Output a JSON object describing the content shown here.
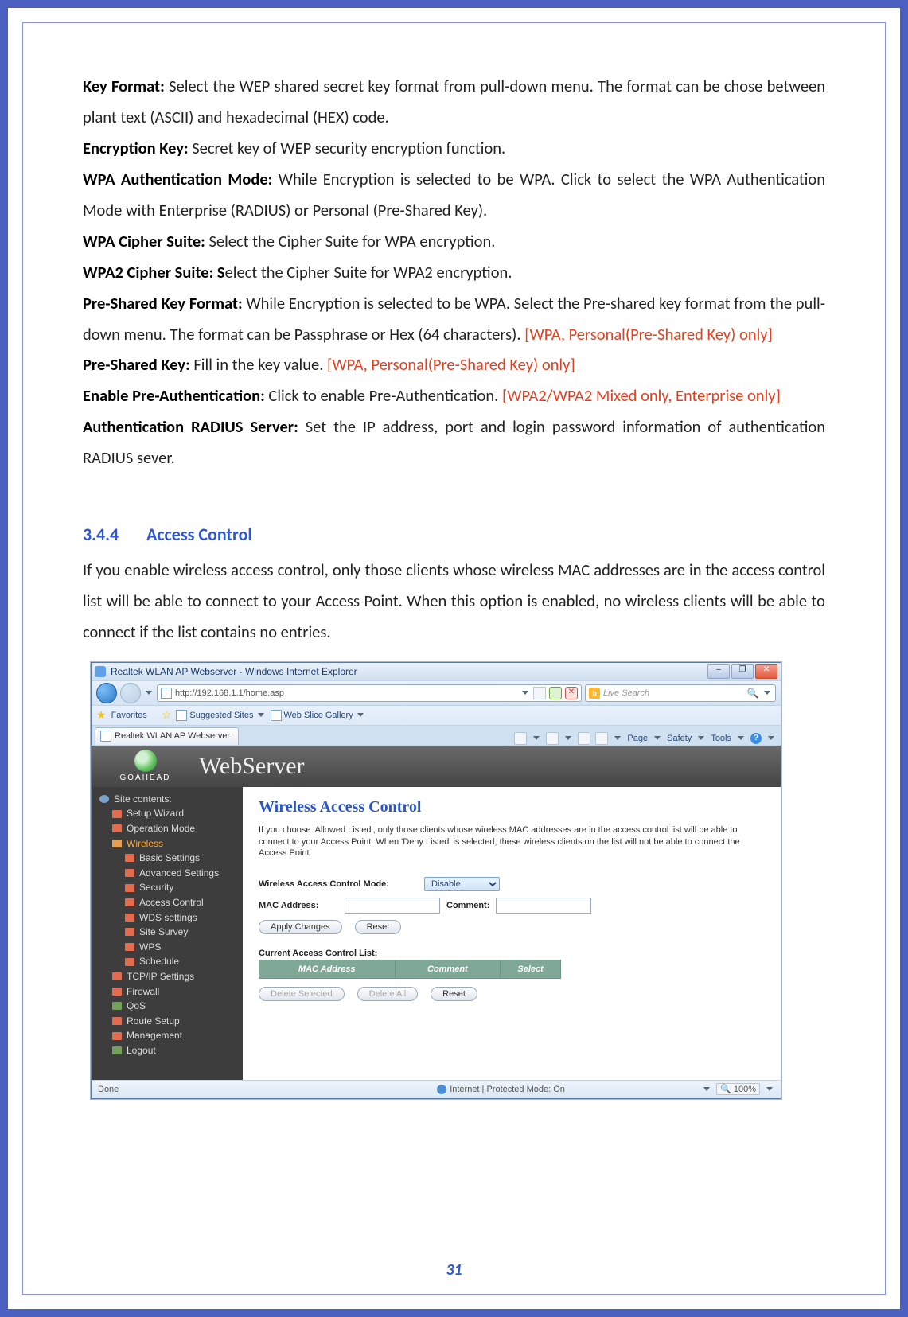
{
  "page_number": "31",
  "doc": {
    "p1_b": "Key Format:",
    "p1_t": " Select the WEP shared secret key format from pull-down menu. The format can be chose between plant text (ASCII) and hexadecimal (HEX) code.",
    "p2_b": "Encryption Key:",
    "p2_t": " Secret key of WEP security encryption function.",
    "p3_b": "WPA Authentication Mode:",
    "p3_t": " While Encryption is selected to be WPA. Click to select the WPA Authentication Mode with Enterprise (RADIUS) or Personal (Pre-Shared Key).",
    "p4_b": "WPA Cipher Suite:",
    "p4_t": " Select the Cipher Suite for WPA encryption.",
    "p5_b": "WPA2 Cipher Suite: S",
    "p5_t": "elect the Cipher Suite for WPA2 encryption.",
    "p6_b": "Pre-Shared Key Format:",
    "p6_t": " While Encryption is selected to be WPA. Select the Pre-shared key format from the pull-down menu. The format can be Passphrase or Hex (64 characters). ",
    "p6_r": "[WPA, Personal(Pre-Shared Key) only]",
    "p7_b": "Pre-Shared Key:",
    "p7_t": " Fill in the key value. ",
    "p7_r": "[WPA, Personal(Pre-Shared Key) only]",
    "p8_b": "Enable Pre-Authentication:",
    "p8_t": " Click to enable Pre-Authentication. ",
    "p8_r": "[WPA2/WPA2 Mixed only, Enterprise only]",
    "p9_b": "Authentication RADIUS Server:",
    "p9_t": " Set the IP address, port and login password information of authentication RADIUS sever."
  },
  "sec": {
    "num": "3.4.4",
    "title": "Access Control",
    "body": "If you enable wireless access control, only those clients whose wireless MAC addresses are in the access control list will be able to connect to your Access Point. When this option is enabled, no wireless clients will be able to connect if the list contains no entries."
  },
  "ie": {
    "title": "Realtek WLAN AP Webserver - Windows Internet Explorer",
    "url": "http://192.168.1.1/home.asp",
    "search_placeholder": "Live Search",
    "fav_label": "Favorites",
    "fav_suggested": "Suggested Sites",
    "fav_webslice": "Web Slice Gallery",
    "tab_title": "Realtek WLAN AP Webserver",
    "cmd_page": "Page",
    "cmd_safety": "Safety",
    "cmd_tools": "Tools",
    "status_left": "Done",
    "status_mid": "Internet | Protected Mode: On",
    "status_zoom": "100%"
  },
  "ws": {
    "brand": "GOAHEAD",
    "logo_text": "WebServer",
    "sidebar": {
      "header": "Site contents:",
      "items": [
        {
          "label": "Setup Wizard"
        },
        {
          "label": "Operation Mode"
        },
        {
          "label": "Wireless",
          "sel": true
        },
        {
          "label": "Basic Settings",
          "indent": true
        },
        {
          "label": "Advanced Settings",
          "indent": true
        },
        {
          "label": "Security",
          "indent": true
        },
        {
          "label": "Access Control",
          "indent": true
        },
        {
          "label": "WDS settings",
          "indent": true
        },
        {
          "label": "Site Survey",
          "indent": true
        },
        {
          "label": "WPS",
          "indent": true
        },
        {
          "label": "Schedule",
          "indent": true
        },
        {
          "label": "TCP/IP Settings"
        },
        {
          "label": "Firewall"
        },
        {
          "label": "QoS"
        },
        {
          "label": "Route Setup"
        },
        {
          "label": "Management"
        },
        {
          "label": "Logout"
        }
      ]
    },
    "main": {
      "heading": "Wireless Access Control",
      "desc": "If you choose 'Allowed Listed', only those clients whose wireless MAC addresses are in the access control list will be able to connect to your Access Point. When 'Deny Listed' is selected, these wireless clients on the list will not be able to connect the Access Point.",
      "mode_label": "Wireless Access Control Mode:",
      "mode_value": "Disable",
      "mac_label": "MAC Address:",
      "comment_label": "Comment:",
      "btn_apply": "Apply Changes",
      "btn_reset": "Reset",
      "list_label": "Current Access Control List:",
      "th_mac": "MAC Address",
      "th_comment": "Comment",
      "th_select": "Select",
      "btn_del_sel": "Delete Selected",
      "btn_del_all": "Delete All",
      "btn_reset2": "Reset"
    }
  }
}
